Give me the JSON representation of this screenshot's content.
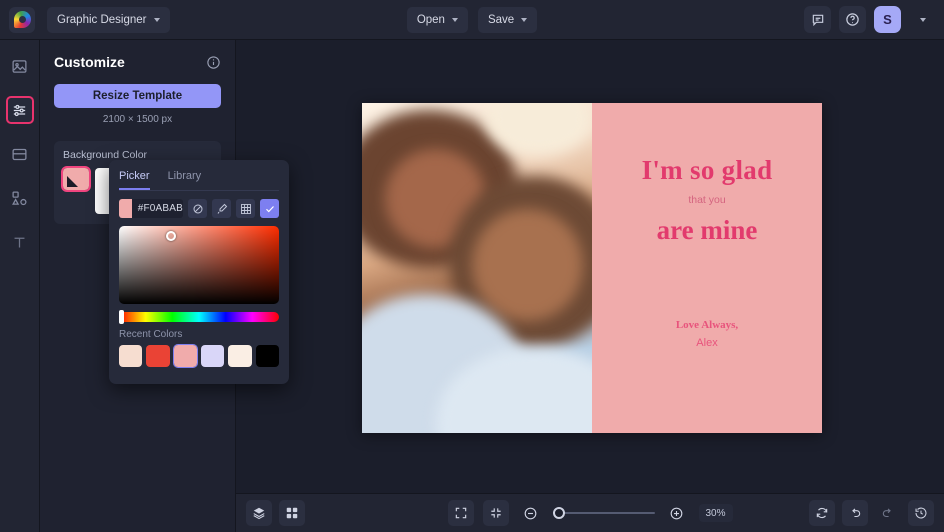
{
  "topbar": {
    "logo_icon": "brand-color-wheel-icon",
    "document_name": "Graphic Designer",
    "open_label": "Open",
    "save_label": "Save",
    "comment_icon": "comment-icon",
    "help_icon": "help-circle-icon",
    "avatar_initial": "S"
  },
  "rail": {
    "items": [
      {
        "name": "images",
        "icon": "image-icon",
        "active": false
      },
      {
        "name": "customize",
        "icon": "sliders-icon",
        "active": true
      },
      {
        "name": "layouts",
        "icon": "layout-icon",
        "active": false
      },
      {
        "name": "elements",
        "icon": "shapes-icon",
        "active": false
      },
      {
        "name": "text",
        "icon": "text-icon",
        "active": false
      }
    ],
    "active_outline_color": "#e8336d"
  },
  "panel": {
    "title": "Customize",
    "info_icon": "info-icon",
    "resize_label": "Resize Template",
    "dimensions": "2100 × 1500 px",
    "background_color_label": "Background Color",
    "swatches": [
      {
        "color": "#f0abab",
        "selected": true
      },
      {
        "color": "#ffffff",
        "selected": false
      },
      {
        "color": "#b0302e",
        "selected": false
      },
      {
        "color": "#c99a1e",
        "selected": false
      }
    ]
  },
  "picker": {
    "tabs": [
      {
        "label": "Picker",
        "active": true
      },
      {
        "label": "Library",
        "active": false
      }
    ],
    "hex_value": "#F0ABAB",
    "swatch_color": "#f0abab",
    "buttons": [
      {
        "name": "no-color",
        "icon": "no-color-icon"
      },
      {
        "name": "eyedropper",
        "icon": "eyedropper-icon"
      },
      {
        "name": "palette-grid",
        "icon": "grid-icon"
      },
      {
        "name": "confirm",
        "icon": "check-icon"
      }
    ],
    "recent_label": "Recent Colors",
    "recent_colors": [
      {
        "color": "#f6ddd0",
        "selected": false
      },
      {
        "color": "#ea4335",
        "selected": false
      },
      {
        "color": "#f0abab",
        "selected": true
      },
      {
        "color": "#d9d6f8",
        "selected": false
      },
      {
        "color": "#faeee4",
        "selected": false
      },
      {
        "color": "#000000",
        "selected": false
      }
    ]
  },
  "canvas": {
    "photo_alt": "smiling-couple-photo",
    "card_bg_color": "#f0abab",
    "headline": "I'm so glad",
    "subline": "that you",
    "headline2": "are mine",
    "signature_line1": "Love Always,",
    "signature_line2": "Alex",
    "text_color": "#e23a6d"
  },
  "bottombar": {
    "layers_icon": "layers-icon",
    "grid_icon": "grid-view-icon",
    "expand_icon": "expand-icon",
    "fit_icon": "fit-to-screen-icon",
    "zoom_out_icon": "zoom-out-icon",
    "zoom_in_icon": "zoom-in-icon",
    "zoom_level": "30%",
    "sync_icon": "sync-icon",
    "undo_icon": "undo-icon",
    "redo_icon": "redo-icon",
    "history_icon": "history-icon"
  }
}
